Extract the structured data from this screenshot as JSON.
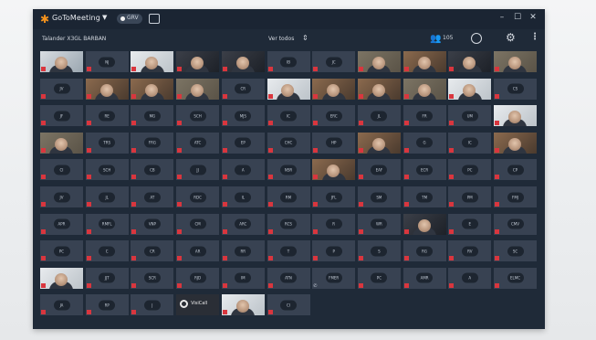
{
  "titlebar": {
    "app_name": "GoToMeeting",
    "record_label": "GRV",
    "colors": {
      "accent": "#f7941d",
      "background": "#1b2533"
    },
    "icons": [
      "gotomeeting-logo-icon",
      "chevron-down-icon",
      "record-icon",
      "screen-share-icon",
      "minimize-icon",
      "maximize-icon",
      "close-icon"
    ]
  },
  "infobar": {
    "meeting": "Talander X3GL BARBAN",
    "view": "Ver todos",
    "attendee_count": "105",
    "icons": [
      "people-icon",
      "chat-icon",
      "settings-gear-icon",
      "more-vertical-icon"
    ]
  },
  "tile_colors": {
    "tile": "#384252",
    "initials_badge": "#1d2530",
    "muted_mic": "#d9363e"
  },
  "grid": {
    "rows": [
      [
        {
          "v": "bright"
        },
        {
          "i": "NJ"
        },
        {
          "v": "pale"
        },
        {
          "v": "dark"
        },
        {
          "v": "dark"
        },
        {
          "i": "IB"
        },
        {
          "i": "JC"
        },
        {
          "v": "room"
        },
        {
          "v": "warm"
        },
        {
          "v": "dark"
        },
        {
          "v": "room"
        }
      ],
      [
        {
          "i": "JV"
        },
        {
          "v": "warm"
        },
        {
          "v": "warm"
        },
        {
          "v": "room"
        },
        {
          "i": "CR"
        },
        {
          "v": "pale"
        },
        {
          "v": "warm"
        },
        {
          "v": "warm"
        },
        {
          "v": "room"
        },
        {
          "v": "pale"
        },
        {
          "i": "CS"
        }
      ],
      [
        {
          "i": "JF"
        },
        {
          "i": "RE"
        },
        {
          "i": "MG"
        },
        {
          "i": "SCH"
        },
        {
          "i": "MJS"
        },
        {
          "i": "IC"
        },
        {
          "i": "ERC"
        },
        {
          "i": "JL"
        },
        {
          "i": "FR"
        },
        {
          "i": "UM"
        },
        {
          "v": "pale"
        }
      ],
      [
        {
          "v": "room"
        },
        {
          "i": "TRS"
        },
        {
          "i": "FRG"
        },
        {
          "i": "ATC"
        },
        {
          "i": "EP"
        },
        {
          "i": "CHC"
        },
        {
          "i": "HP"
        },
        {
          "v": "warm"
        },
        {
          "i": "G"
        },
        {
          "i": "IC"
        },
        {
          "v": "warm"
        }
      ],
      [
        {
          "i": "CI"
        },
        {
          "i": "SCH"
        },
        {
          "i": "CB"
        },
        {
          "i": "JJ"
        },
        {
          "i": "A"
        },
        {
          "i": "NSR"
        },
        {
          "v": "warm"
        },
        {
          "i": "EAF"
        },
        {
          "i": "ECR"
        },
        {
          "i": "PC"
        },
        {
          "i": "CP"
        }
      ],
      [
        {
          "i": "JV"
        },
        {
          "i": "JL"
        },
        {
          "i": "AT"
        },
        {
          "i": "RDC"
        },
        {
          "i": "IL"
        },
        {
          "i": "RM"
        },
        {
          "i": "JFL"
        },
        {
          "i": "SM"
        },
        {
          "i": "TM"
        },
        {
          "i": "PM"
        },
        {
          "i": "FMJ"
        }
      ],
      [
        {
          "i": "APR"
        },
        {
          "i": "RMFL"
        },
        {
          "i": "VNP"
        },
        {
          "i": "CM"
        },
        {
          "i": "ARC"
        },
        {
          "i": "RCS"
        },
        {
          "i": "R"
        },
        {
          "i": "WR"
        },
        {
          "v": "dark"
        },
        {
          "i": "E"
        },
        {
          "i": "CMV"
        }
      ],
      [
        {
          "i": "PC"
        },
        {
          "i": "C"
        },
        {
          "i": "CR"
        },
        {
          "i": "AR"
        },
        {
          "i": "RR"
        },
        {
          "i": "T"
        },
        {
          "i": "P"
        },
        {
          "i": "S"
        },
        {
          "i": "RG"
        },
        {
          "i": "RV"
        },
        {
          "i": "SC"
        }
      ],
      [
        {
          "v": "pale"
        },
        {
          "i": "JJT"
        },
        {
          "i": "SCR"
        },
        {
          "i": "RJD"
        },
        {
          "i": "IM"
        },
        {
          "i": "ATN"
        },
        {
          "i": "FMER",
          "phone": true
        },
        {
          "i": "PC"
        },
        {
          "i": "AMR"
        },
        {
          "i": "A"
        },
        {
          "i": "ELMC"
        }
      ],
      [
        {
          "i": "JA"
        },
        {
          "i": "RP"
        },
        {
          "i": "J"
        },
        {
          "logo": "VisiCall"
        },
        {
          "v": "pale"
        },
        {
          "i": "CI"
        }
      ]
    ]
  }
}
